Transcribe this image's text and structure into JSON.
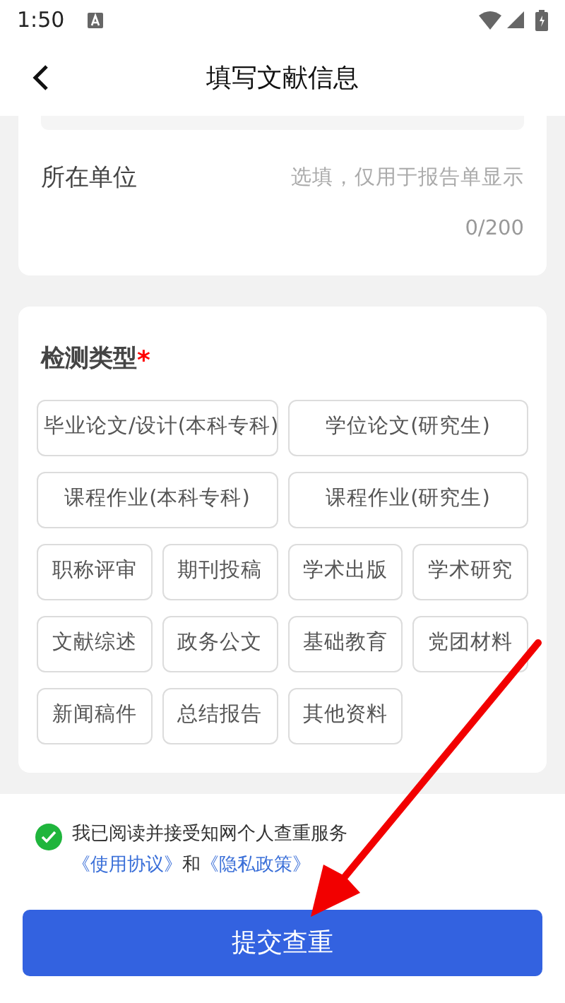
{
  "status_bar": {
    "time": "1:50"
  },
  "header": {
    "title": "填写文献信息"
  },
  "unit_field": {
    "label": "所在单位",
    "placeholder": "选填，仅用于报告单显示",
    "counter": "0/200"
  },
  "detection_type": {
    "label": "检测类型",
    "required_mark": "*",
    "options": [
      {
        "label": "毕业论文/设计(本科专科)",
        "kind": "wide",
        "selected": false
      },
      {
        "label": "学位论文(研究生)",
        "kind": "wide",
        "selected": false
      },
      {
        "label": "课程作业(本科专科)",
        "kind": "wide",
        "selected": false
      },
      {
        "label": "课程作业(研究生)",
        "kind": "wide",
        "selected": false
      },
      {
        "label": "职称评审",
        "kind": "normal",
        "selected": false
      },
      {
        "label": "期刊投稿",
        "kind": "normal",
        "selected": false
      },
      {
        "label": "学术出版",
        "kind": "normal",
        "selected": false
      },
      {
        "label": "学术研究",
        "kind": "normal",
        "selected": false
      },
      {
        "label": "文献综述",
        "kind": "normal",
        "selected": false
      },
      {
        "label": "政务公文",
        "kind": "normal",
        "selected": false
      },
      {
        "label": "基础教育",
        "kind": "normal",
        "selected": false
      },
      {
        "label": "党团材料",
        "kind": "normal",
        "selected": false
      },
      {
        "label": "新闻稿件",
        "kind": "normal",
        "selected": false
      },
      {
        "label": "总结报告",
        "kind": "normal",
        "selected": false
      },
      {
        "label": "其他资料",
        "kind": "normal",
        "selected": false
      }
    ]
  },
  "agreement": {
    "checked": true,
    "parts": [
      {
        "kind": "text",
        "text": "我已阅读并接受知网个人查重服务"
      },
      {
        "kind": "link",
        "text": "《使用协议》"
      },
      {
        "kind": "text",
        "text": "和"
      },
      {
        "kind": "link",
        "text": "《隐私政策》"
      }
    ]
  },
  "submit_button": {
    "label": "提交查重"
  }
}
